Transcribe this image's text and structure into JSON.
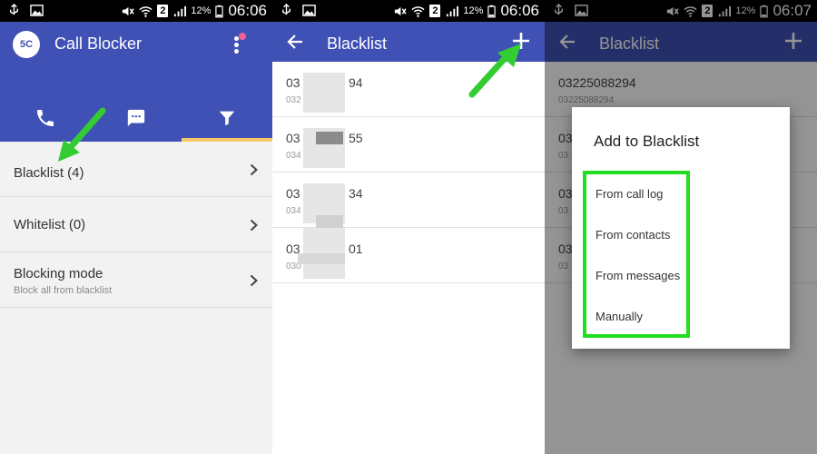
{
  "status_bar": {
    "network_badge": "2",
    "battery": "12%",
    "time_1": "06:06",
    "time_2": "06:06",
    "time_3": "06:07"
  },
  "screen1": {
    "app_title": "Call Blocker",
    "logo_text": "5C",
    "tabs": [
      {
        "icon": "phone-icon"
      },
      {
        "icon": "message-icon"
      },
      {
        "icon": "filter-icon",
        "active": true
      }
    ],
    "rows": [
      {
        "label": "Blacklist (4)"
      },
      {
        "label": "Whitelist (0)"
      },
      {
        "label": "Blocking mode",
        "sub": "Block all from blacklist"
      }
    ]
  },
  "screen2": {
    "title": "Blacklist",
    "entries": [
      {
        "num_a": "03",
        "num_b": "94",
        "sub": "032"
      },
      {
        "num_a": "03",
        "num_b": "55",
        "sub": "034"
      },
      {
        "num_a": "03",
        "num_b": "34",
        "sub": "034"
      },
      {
        "num_a": "03",
        "num_b": "01",
        "sub": "030"
      }
    ]
  },
  "screen3": {
    "title": "Blacklist",
    "entries": [
      {
        "num": "03225088294",
        "sub": "03225088294"
      },
      {
        "num": "03",
        "sub": "03"
      },
      {
        "num": "03",
        "sub": "03"
      },
      {
        "num": "03",
        "sub": "03"
      }
    ],
    "dialog": {
      "title": "Add to Blacklist",
      "options": [
        "From call log",
        "From contacts",
        "From messages",
        "Manually"
      ]
    }
  },
  "colors": {
    "primary": "#3f51b5",
    "tab_indicator": "#f4c969",
    "highlight": "#22dd22",
    "notification_dot": "#f06292"
  }
}
